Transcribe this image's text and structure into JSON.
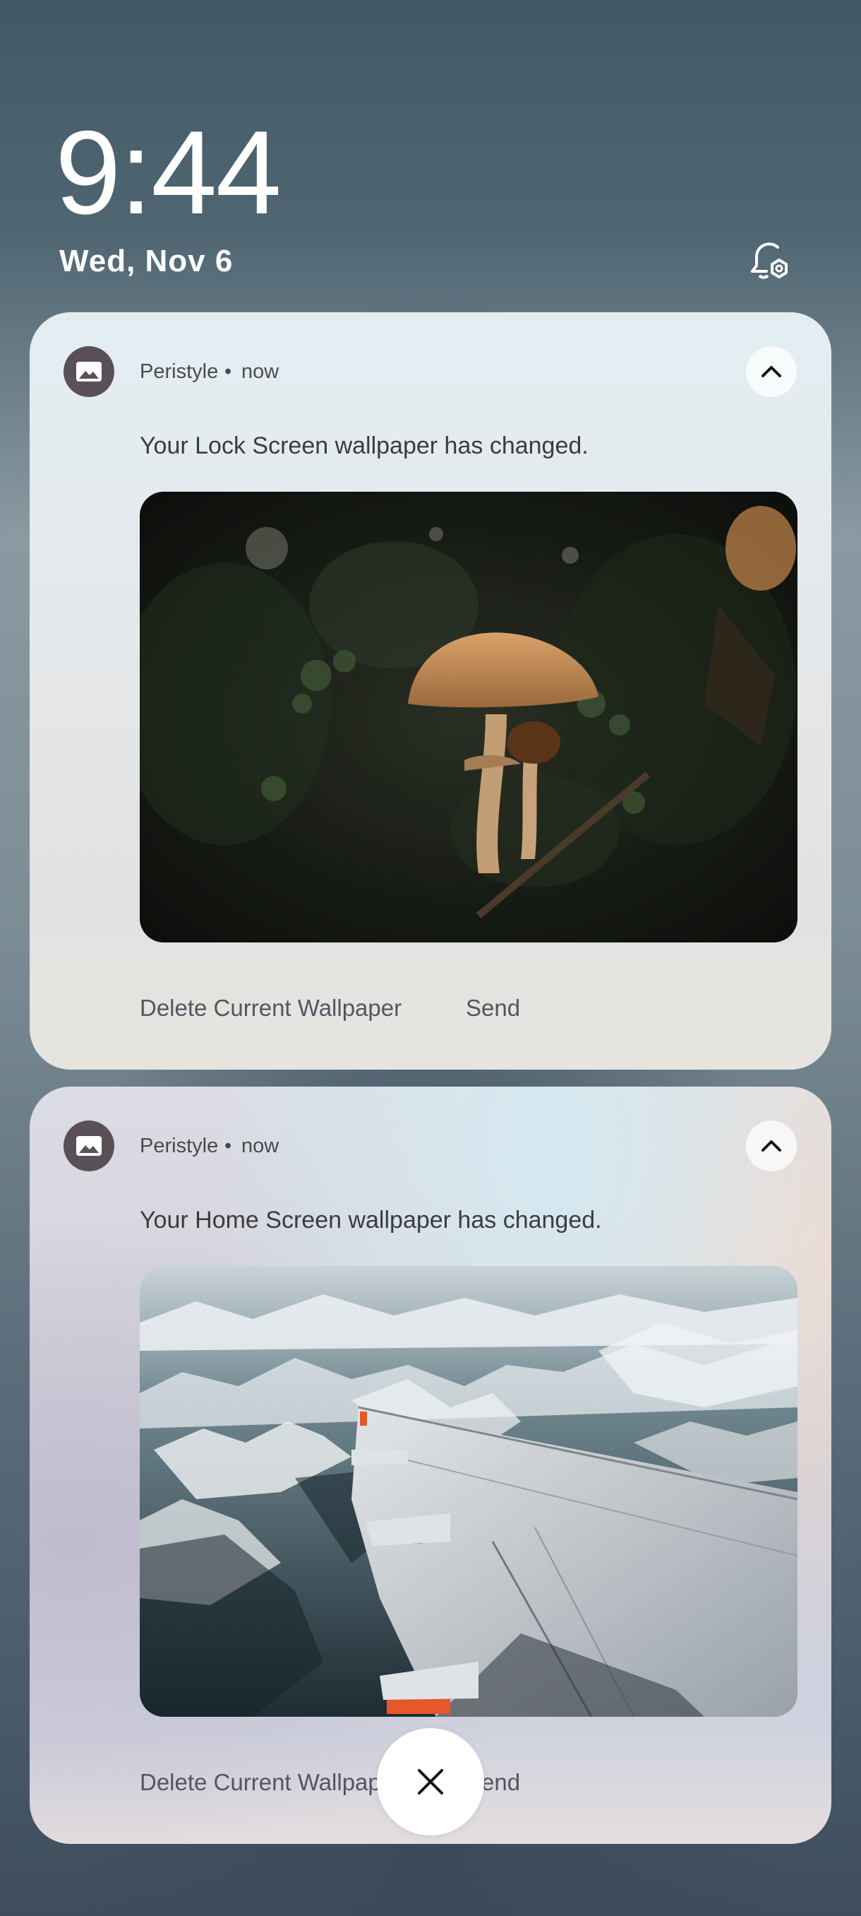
{
  "lock_screen": {
    "time": "9:44",
    "date": "Wed, Nov 6",
    "notification_settings_icon": "bell-gear-icon"
  },
  "notifications": [
    {
      "app_name": "Peristyle",
      "separator": "•",
      "time": "now",
      "app_icon": "image-icon",
      "message": "Your Lock Screen wallpaper has changed.",
      "preview_subject": "mushrooms-photo",
      "actions": [
        "Delete Current Wallpaper",
        "Send"
      ],
      "expanded": true
    },
    {
      "app_name": "Peristyle",
      "separator": "•",
      "time": "now",
      "app_icon": "image-icon",
      "message": "Your Home Screen wallpaper has changed.",
      "preview_subject": "airplane-wing-mountains-photo",
      "actions": [
        "Delete Current Wallpaper",
        "Send"
      ],
      "expanded": true
    }
  ],
  "dismiss_all": {
    "icon": "close-icon"
  },
  "colors": {
    "text_primary": "#3c3c40",
    "text_secondary": "#4a4a4e",
    "app_icon_bg": "#5a5058"
  }
}
